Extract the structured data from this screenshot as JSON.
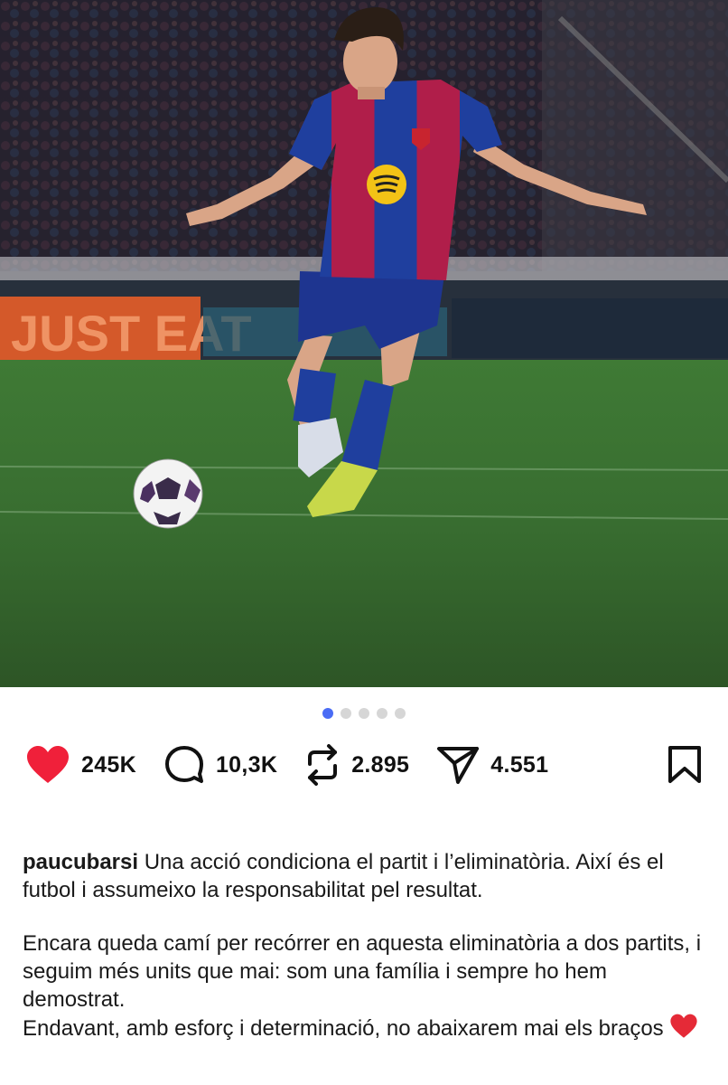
{
  "post": {
    "carousel": {
      "count": 5,
      "active_index": 0
    },
    "photo_banner_text": "JUST EAT",
    "actions": {
      "likes": "245K",
      "comments": "10,3K",
      "reposts": "2.895",
      "shares": "4.551"
    },
    "caption": {
      "username": "paucubarsi",
      "line1": "Una acció condiciona el partit i l’eliminatòria. Així és el futbol i assumeixo la responsabilitat pel resultat.",
      "line2": "Encara queda camí per recórrer en aquesta eliminatòria a dos partits, i seguim més units que mai: som una família i sempre ho hem demostrat.",
      "line3": "Endavant, amb esforç i determinació, no abaixarem mai els braços"
    }
  },
  "colors": {
    "like": "#f0203a",
    "dot_active": "#4a6cf5",
    "dot_inactive": "#d6d6d6",
    "kit_blue": "#1f3f9e",
    "kit_red": "#b01e4a"
  },
  "icons": [
    "heart-icon",
    "comment-icon",
    "repost-icon",
    "share-icon",
    "bookmark-icon",
    "red-heart-emoji"
  ]
}
